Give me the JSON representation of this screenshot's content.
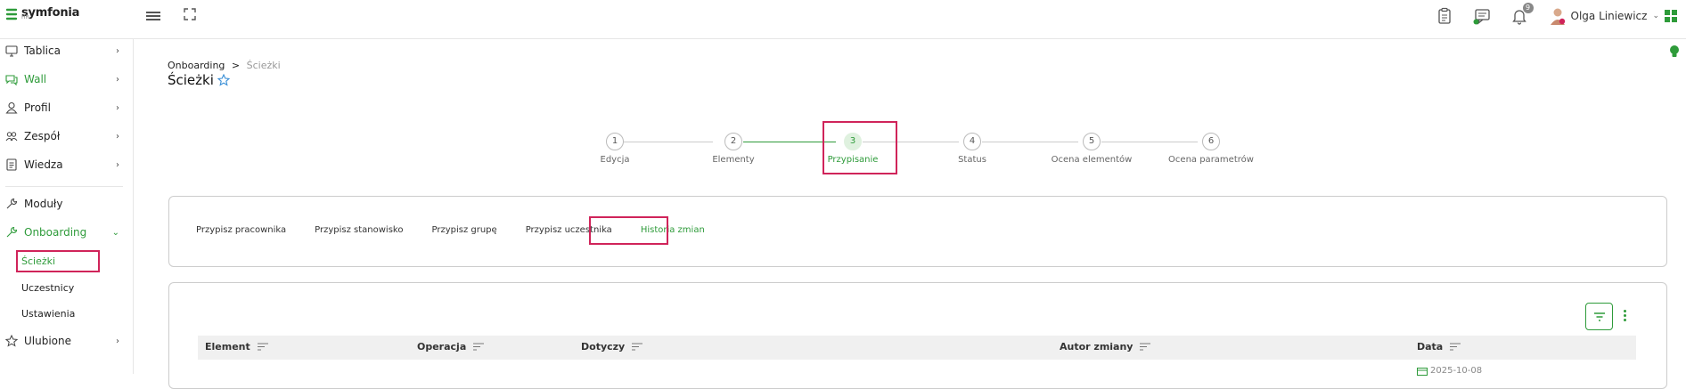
{
  "app": {
    "logo_text": "symfonia",
    "logo_sub": "HR",
    "brand_color": "#2e9b3a",
    "highlight_color": "#d0245a"
  },
  "topbar": {
    "notifications_count": "9",
    "user_name": "Olga Liniewicz"
  },
  "sidebar": {
    "items": [
      {
        "label": "Tablica",
        "icon": "monitor-icon"
      },
      {
        "label": "Wall",
        "icon": "chat-icon"
      },
      {
        "label": "Profil",
        "icon": "user-icon"
      },
      {
        "label": "Zespół",
        "icon": "team-icon"
      },
      {
        "label": "Wiedza",
        "icon": "document-icon"
      },
      {
        "label": "Moduły",
        "icon": "wrench-icon"
      },
      {
        "label": "Onboarding",
        "icon": "wrench-icon"
      },
      {
        "label": "Ulubione",
        "icon": "star-icon"
      }
    ],
    "sub_items": [
      {
        "label": "Ścieżki"
      },
      {
        "label": "Uczestnicy"
      },
      {
        "label": "Ustawienia"
      }
    ]
  },
  "breadcrumb": {
    "root": "Onboarding",
    "separator": ">",
    "current": "Ścieżki"
  },
  "page_title": "Ścieżki",
  "stepper": {
    "active_step": 3,
    "steps": [
      {
        "num": "1",
        "label": "Edycja"
      },
      {
        "num": "2",
        "label": "Elementy"
      },
      {
        "num": "3",
        "label": "Przypisanie"
      },
      {
        "num": "4",
        "label": "Status"
      },
      {
        "num": "5",
        "label": "Ocena elementów"
      },
      {
        "num": "6",
        "label": "Ocena parametrów"
      }
    ]
  },
  "tabs": [
    {
      "label": "Przypisz pracownika"
    },
    {
      "label": "Przypisz stanowisko"
    },
    {
      "label": "Przypisz grupę"
    },
    {
      "label": "Przypisz uczestnika"
    },
    {
      "label": "Historia zmian"
    }
  ],
  "active_tab": "Historia zmian",
  "table": {
    "columns": [
      {
        "label": "Element"
      },
      {
        "label": "Operacja"
      },
      {
        "label": "Dotyczy"
      },
      {
        "label": "Autor zmiany"
      },
      {
        "label": "Data"
      }
    ],
    "first_row_date": "2025-10-08"
  }
}
